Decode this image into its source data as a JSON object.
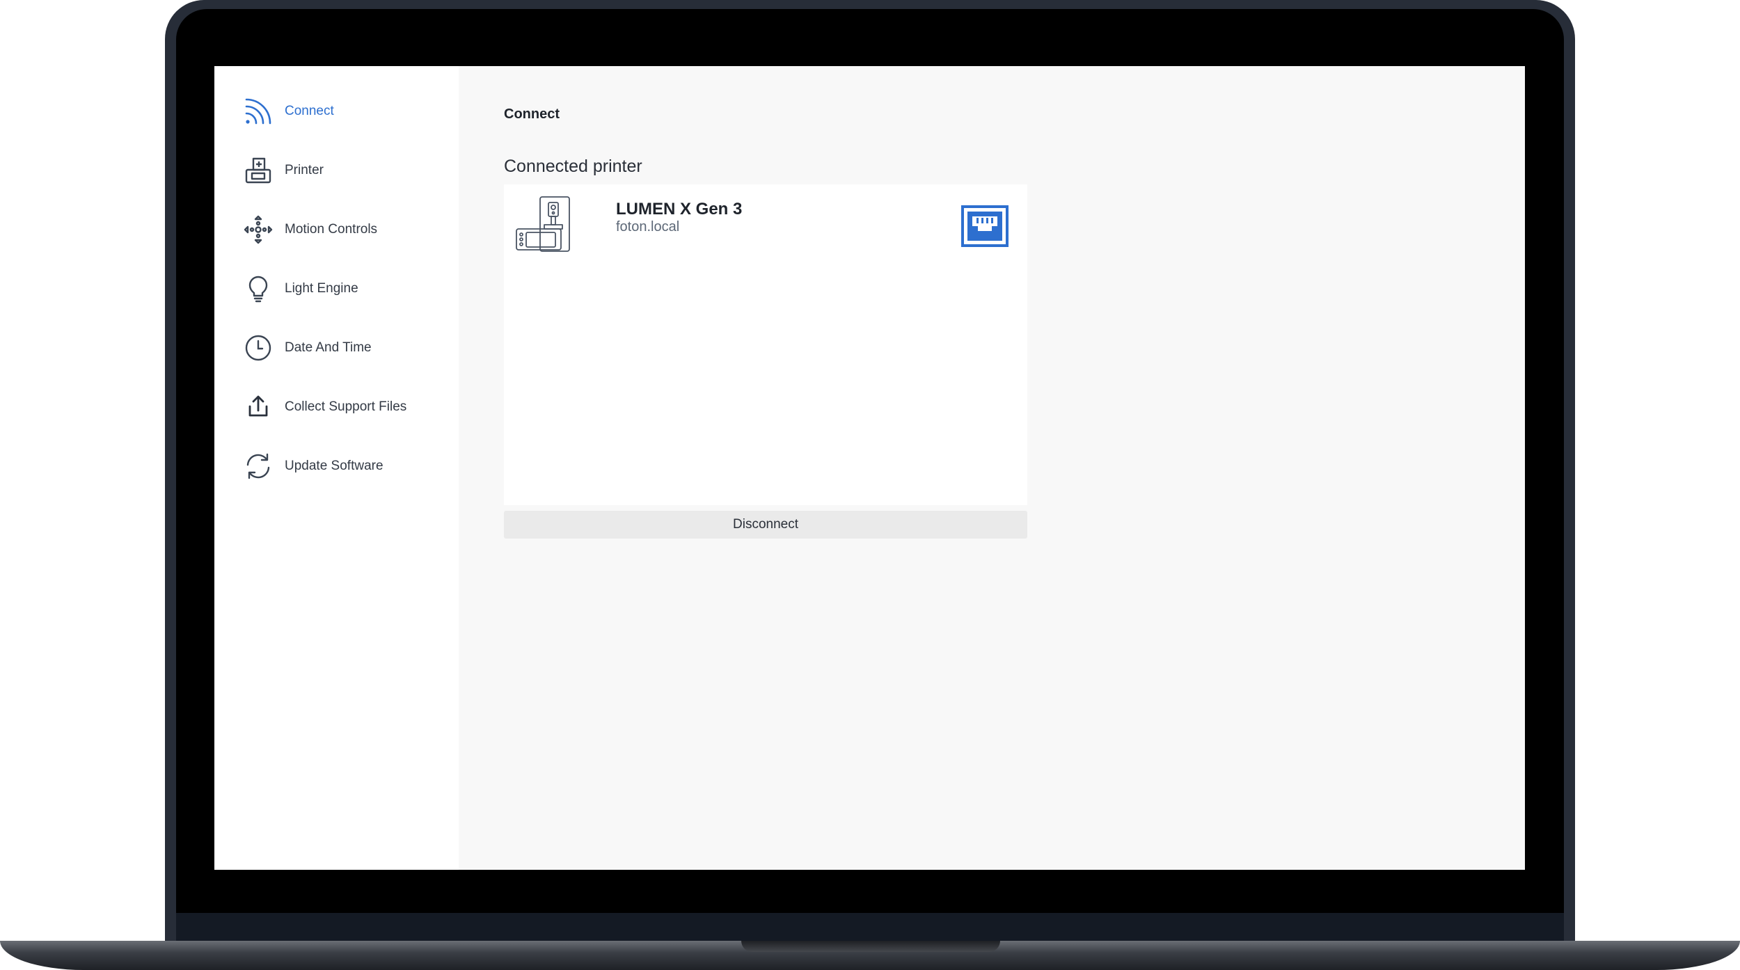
{
  "sidebar": {
    "items": [
      {
        "label": "Connect",
        "icon": "signal-icon",
        "active": true
      },
      {
        "label": "Printer",
        "icon": "printer-icon"
      },
      {
        "label": "Motion Controls",
        "icon": "move-arrows-icon"
      },
      {
        "label": "Light Engine",
        "icon": "lightbulb-icon"
      },
      {
        "label": "Date And Time",
        "icon": "clock-icon"
      },
      {
        "label": "Collect Support Files",
        "icon": "upload-icon"
      },
      {
        "label": "Update Software",
        "icon": "refresh-icon"
      }
    ]
  },
  "main": {
    "title": "Connect",
    "section_title": "Connected printer",
    "printer": {
      "name": "LUMEN X Gen 3",
      "host": "foton.local",
      "connection_icon": "ethernet-icon"
    },
    "disconnect_label": "Disconnect"
  },
  "colors": {
    "accent": "#2d6fcf",
    "bezel": "#000000",
    "frame": "#272d38",
    "sidebar_bg": "#ffffff",
    "content_bg": "#f8f8f8",
    "button_bg": "#eaeaea"
  }
}
